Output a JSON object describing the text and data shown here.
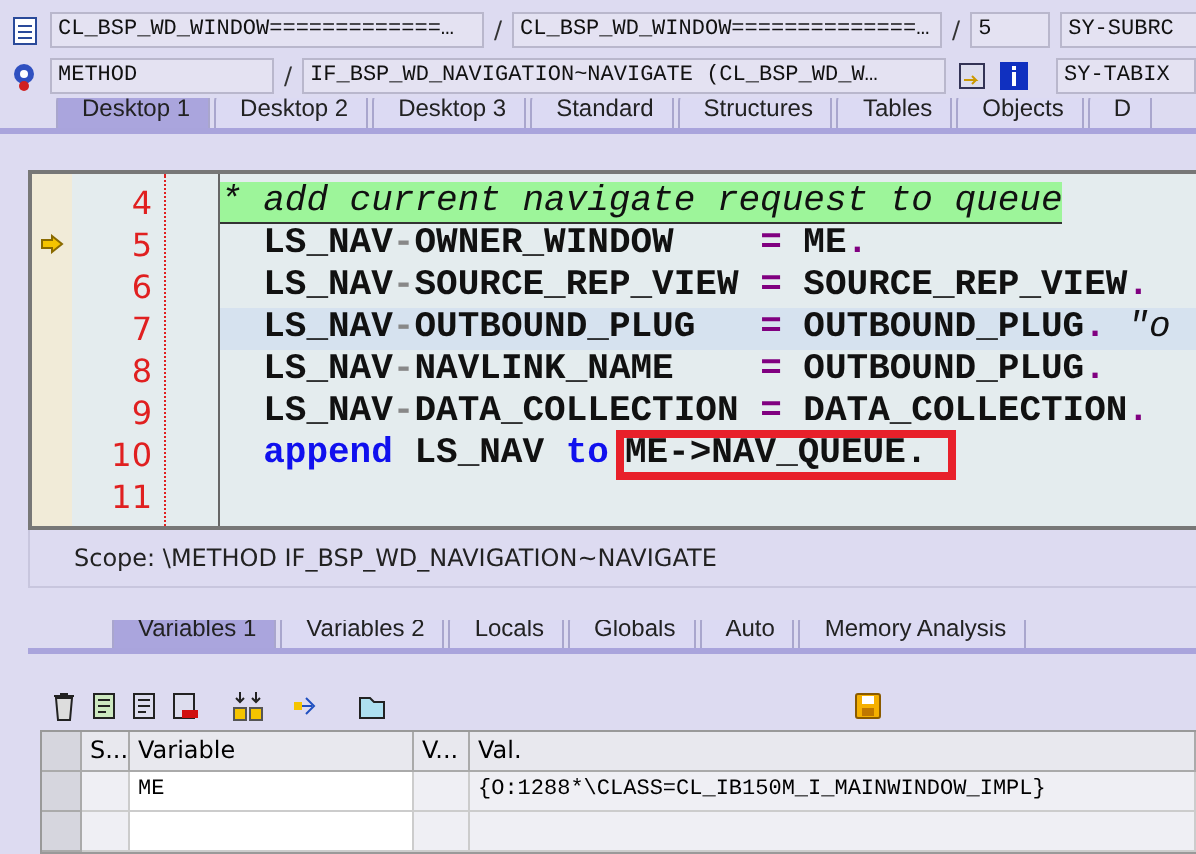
{
  "header": {
    "row_1": {
      "program": "CL_BSP_WD_WINDOW=============…",
      "separator_1": "/",
      "include": "CL_BSP_WD_WINDOW==============…",
      "separator_2": "/",
      "line": "5",
      "field": "SY-SUBRC"
    },
    "row_2": {
      "event_type": "METHOD",
      "separator": "/",
      "event": "IF_BSP_WD_NAVIGATION~NAVIGATE (CL_BSP_WD_W…",
      "field": "SY-TABIX"
    }
  },
  "desktop_tabs": [
    {
      "label": "Desktop 1",
      "selected": true
    },
    {
      "label": "Desktop 2",
      "selected": false
    },
    {
      "label": "Desktop 3",
      "selected": false
    },
    {
      "label": "Standard",
      "selected": false
    },
    {
      "label": "Structures",
      "selected": false
    },
    {
      "label": "Tables",
      "selected": false
    },
    {
      "label": "Objects",
      "selected": false
    },
    {
      "label": "D",
      "selected": false
    }
  ],
  "code_lines": [
    {
      "number": "4",
      "current": false,
      "cursor_line": false,
      "tokens": [
        {
          "kind": "comment",
          "text": "* add current navigate request to queue"
        }
      ]
    },
    {
      "number": "5",
      "current": true,
      "cursor_line": false,
      "tokens": [
        {
          "kind": "name",
          "text": "  LS_NAV"
        },
        {
          "kind": "sep",
          "text": "-"
        },
        {
          "kind": "name",
          "text": "OWNER_WINDOW    "
        },
        {
          "kind": "op",
          "text": "="
        },
        {
          "kind": "name",
          "text": " ME"
        },
        {
          "kind": "op",
          "text": "."
        }
      ]
    },
    {
      "number": "6",
      "current": false,
      "cursor_line": false,
      "tokens": [
        {
          "kind": "name",
          "text": "  LS_NAV"
        },
        {
          "kind": "sep",
          "text": "-"
        },
        {
          "kind": "name",
          "text": "SOURCE_REP_VIEW "
        },
        {
          "kind": "op",
          "text": "="
        },
        {
          "kind": "name",
          "text": " SOURCE_REP_VIEW"
        },
        {
          "kind": "op",
          "text": "."
        }
      ]
    },
    {
      "number": "7",
      "current": false,
      "cursor_line": true,
      "tokens": [
        {
          "kind": "name",
          "text": "  LS_NAV"
        },
        {
          "kind": "sep",
          "text": "-"
        },
        {
          "kind": "name",
          "text": "OUTBOUND_PLUG   "
        },
        {
          "kind": "op",
          "text": "="
        },
        {
          "kind": "name",
          "text": " OUTBOUND_PLUG"
        },
        {
          "kind": "op",
          "text": "."
        },
        {
          "kind": "comment",
          "text": " \"o"
        }
      ]
    },
    {
      "number": "8",
      "current": false,
      "cursor_line": false,
      "tokens": [
        {
          "kind": "name",
          "text": "  LS_NAV"
        },
        {
          "kind": "sep",
          "text": "-"
        },
        {
          "kind": "name",
          "text": "NAVLINK_NAME    "
        },
        {
          "kind": "op",
          "text": "="
        },
        {
          "kind": "name",
          "text": " OUTBOUND_PLUG"
        },
        {
          "kind": "op",
          "text": "."
        }
      ]
    },
    {
      "number": "9",
      "current": false,
      "cursor_line": false,
      "tokens": [
        {
          "kind": "name",
          "text": "  LS_NAV"
        },
        {
          "kind": "sep",
          "text": "-"
        },
        {
          "kind": "name",
          "text": "DATA_COLLECTION "
        },
        {
          "kind": "op",
          "text": "="
        },
        {
          "kind": "name",
          "text": " DATA_COLLECTION"
        },
        {
          "kind": "op",
          "text": "."
        }
      ]
    },
    {
      "number": "10",
      "current": false,
      "cursor_line": false,
      "tokens": [
        {
          "kind": "keyword",
          "text": "  append"
        },
        {
          "kind": "name",
          "text": " LS_NAV "
        },
        {
          "kind": "keyword",
          "text": "to"
        },
        {
          "kind": "boxed",
          "text": "ME->NAV_QUEUE."
        }
      ]
    },
    {
      "number": "11",
      "current": false,
      "cursor_line": false
    }
  ],
  "scope": "Scope: \\METHOD IF_BSP_WD_NAVIGATION~NAVIGATE",
  "variable_tabs": [
    {
      "label": "Variables 1",
      "selected": true
    },
    {
      "label": "Variables 2",
      "selected": false
    },
    {
      "label": "Locals",
      "selected": false
    },
    {
      "label": "Globals",
      "selected": false
    },
    {
      "label": "Auto",
      "selected": false
    },
    {
      "label": "Memory Analysis",
      "selected": false
    }
  ],
  "table": {
    "columns": [
      "S...",
      "Variable",
      "V...",
      "Val."
    ],
    "rows": [
      {
        "variable": "ME",
        "value": "{O:1288*\\CLASS=CL_IB150M_I_MAINWINDOW_IMPL}"
      }
    ]
  }
}
